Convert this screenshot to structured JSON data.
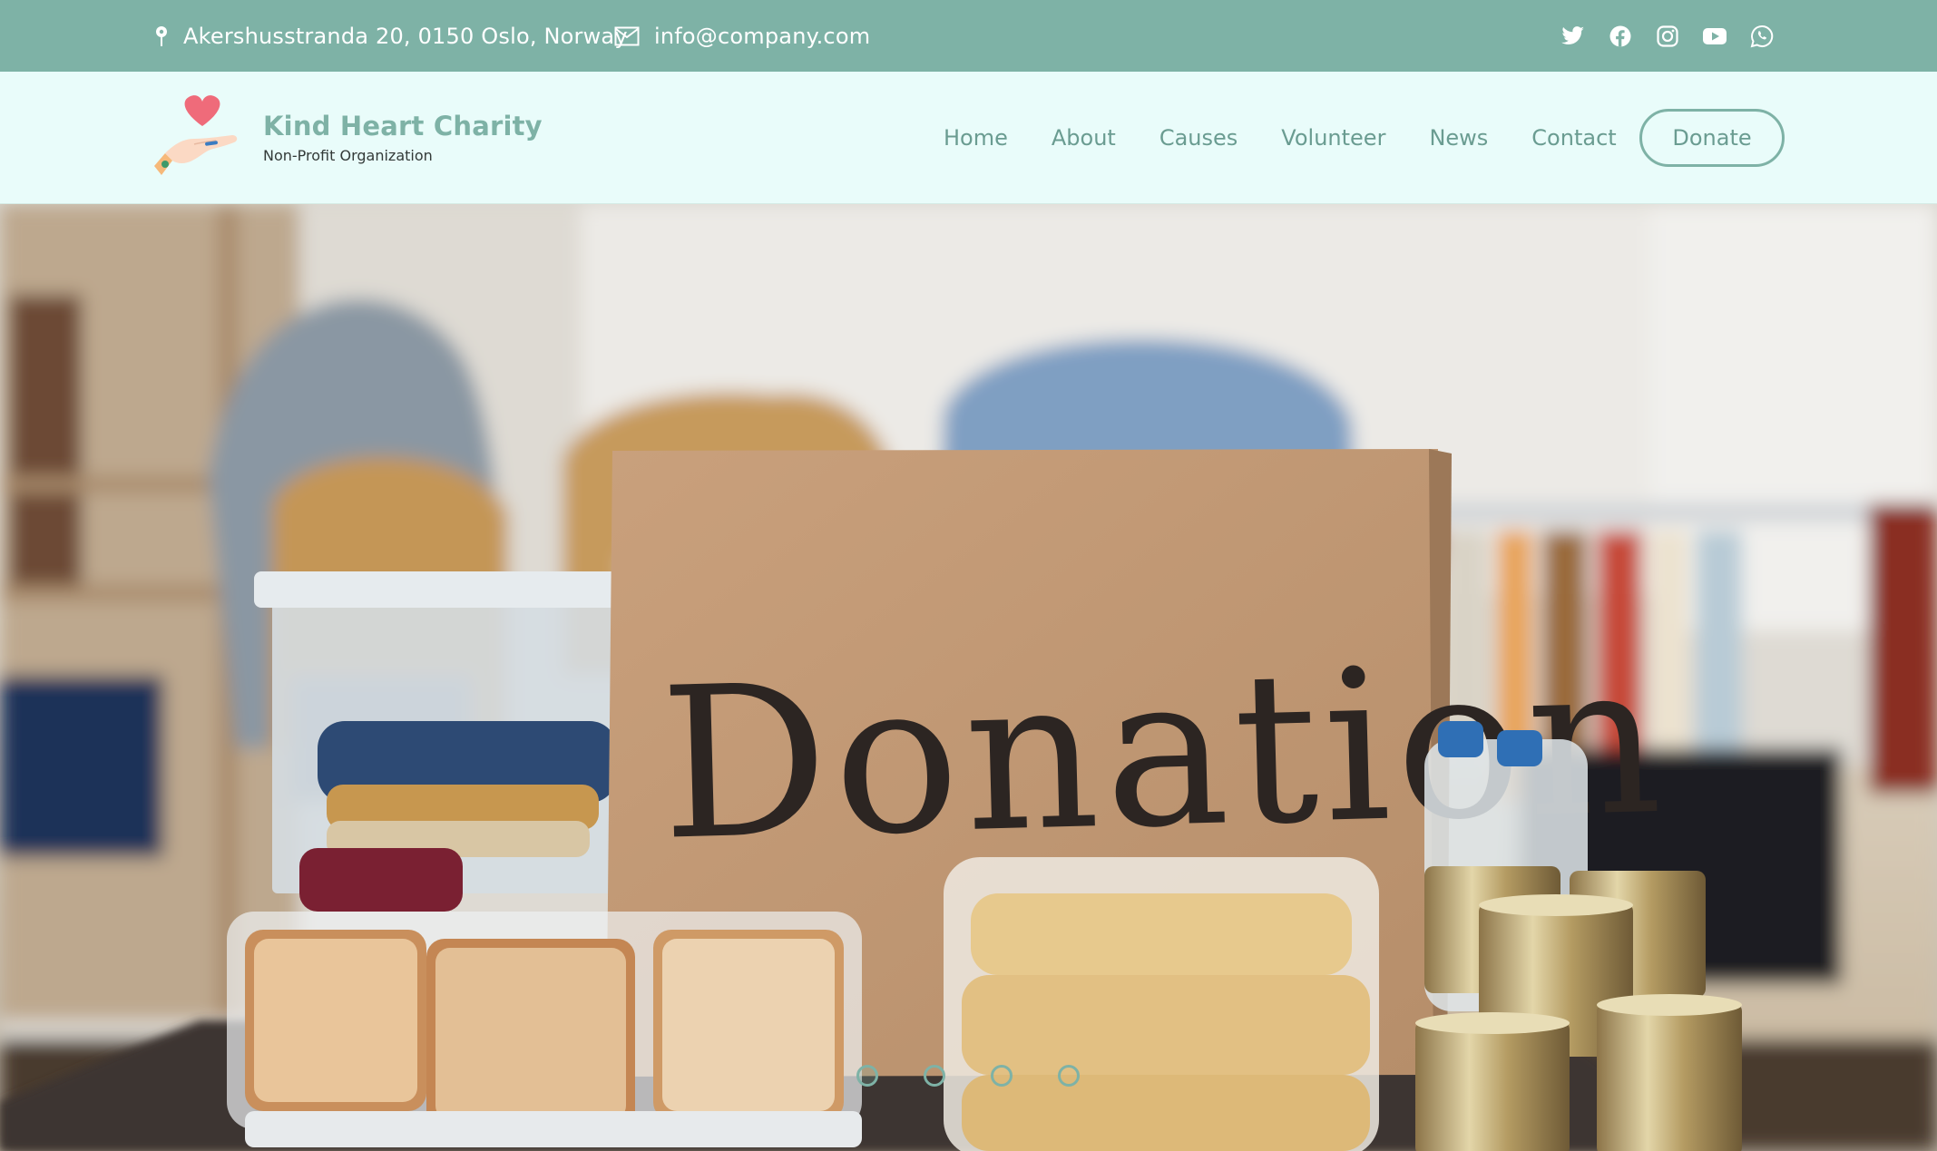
{
  "topbar": {
    "address": "Akershusstranda 20, 0150 Oslo, Norway",
    "email": "info@company.com",
    "address_icon": "map-pin-icon",
    "email_icon": "envelope-icon",
    "social": [
      "twitter-icon",
      "facebook-icon",
      "instagram-icon",
      "youtube-icon",
      "whatsapp-icon"
    ],
    "bg_color": "#7eb2a6"
  },
  "brand": {
    "name": "Kind Heart Charity",
    "tagline": "Non-Profit Organization",
    "logo_icon": "heart-hand-logo",
    "accent_color": "#7eb2a6"
  },
  "nav": {
    "items": [
      "Home",
      "About",
      "Causes",
      "Volunteer",
      "News",
      "Contact"
    ],
    "donate_label": "Donate"
  },
  "hero": {
    "sign_text": "Donation",
    "slide_count": 4,
    "active_slide": 1
  }
}
